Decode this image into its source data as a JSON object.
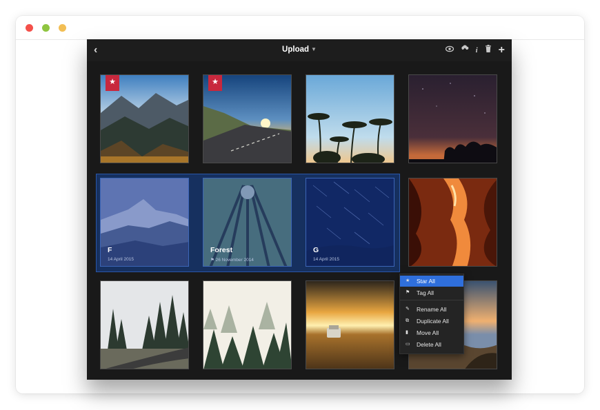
{
  "window": {
    "controls": [
      "close",
      "minimize",
      "zoom"
    ]
  },
  "toolbar": {
    "title": "Upload",
    "back_icon": "chevron-left-icon",
    "tools": [
      "eye-icon",
      "cloud-upload-icon",
      "info-icon",
      "trash-icon",
      "plus-icon"
    ]
  },
  "tiles": [
    {
      "id": "mountain-sunset",
      "starred": true,
      "selected": false
    },
    {
      "id": "road-sunset",
      "starred": true,
      "selected": false
    },
    {
      "id": "palm-trees",
      "starred": false,
      "selected": false
    },
    {
      "id": "night-sky",
      "starred": false,
      "selected": false
    },
    {
      "id": "snowy-peak",
      "starred": false,
      "selected": true,
      "title": "F",
      "date": "14 April 2015"
    },
    {
      "id": "forest",
      "starred": false,
      "selected": true,
      "title": "Forest",
      "date": "26 November 2014",
      "date_icon": "tag-icon"
    },
    {
      "id": "star-trails",
      "starred": false,
      "selected": true,
      "title": "G",
      "date": "14 April 2015"
    },
    {
      "id": "canyon",
      "starred": false,
      "selected": false
    },
    {
      "id": "misty-road",
      "starred": false,
      "selected": false
    },
    {
      "id": "foggy-forest",
      "starred": false,
      "selected": false
    },
    {
      "id": "desert-car",
      "starred": false,
      "selected": false
    },
    {
      "id": "coast-sunset",
      "starred": false,
      "selected": false
    }
  ],
  "context_menu": {
    "items": [
      {
        "label": "Star All",
        "icon": "star-icon",
        "active": true
      },
      {
        "label": "Tag All",
        "icon": "tag-icon",
        "active": false
      },
      {
        "label": "Rename All",
        "icon": "pencil-icon",
        "active": false
      },
      {
        "label": "Duplicate All",
        "icon": "duplicate-icon",
        "active": false
      },
      {
        "label": "Move All",
        "icon": "folder-icon",
        "active": false
      },
      {
        "label": "Delete All",
        "icon": "trash-icon",
        "active": false
      }
    ]
  },
  "colors": {
    "accent": "#2f6fdc",
    "star_badge": "#c8283d",
    "selection": "#16305f"
  }
}
